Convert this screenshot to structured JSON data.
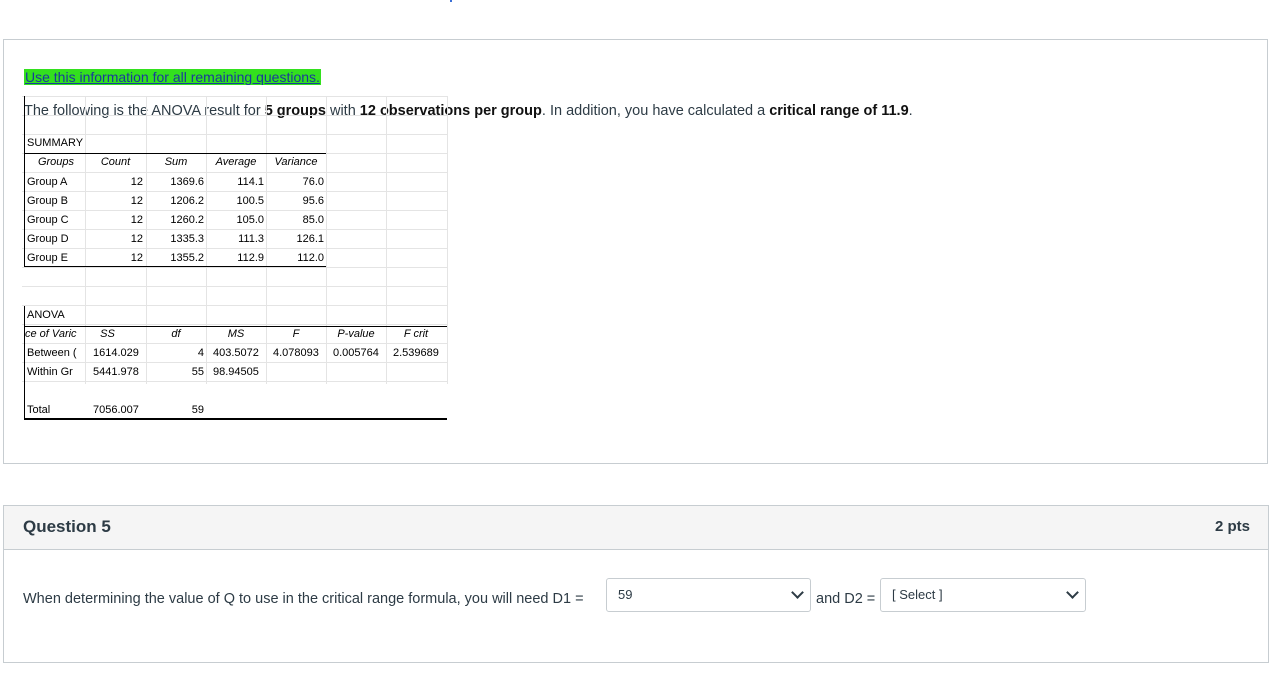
{
  "info": {
    "highlight": "Use this information for all remaining questions.",
    "intro_1": "The following is the ANOVA result for ",
    "intro_2": "5 groups",
    "intro_3": " with ",
    "intro_4": "12 observations per group",
    "intro_5": ". In addition, you have calculated a ",
    "intro_6": "critical range of 11.9",
    "intro_7": "."
  },
  "excel": {
    "summary_label": "SUMMARY",
    "summary_headers": [
      "Groups",
      "Count",
      "Sum",
      "Average",
      "Variance"
    ],
    "summary_rows": [
      [
        "Group A",
        "12",
        "1369.6",
        "114.1",
        "76.0"
      ],
      [
        "Group B",
        "12",
        "1206.2",
        "100.5",
        "95.6"
      ],
      [
        "Group C",
        "12",
        "1260.2",
        "105.0",
        "85.0"
      ],
      [
        "Group D",
        "12",
        "1335.3",
        "111.3",
        "126.1"
      ],
      [
        "Group E",
        "12",
        "1355.2",
        "112.9",
        "112.0"
      ]
    ],
    "anova_label": "ANOVA",
    "anova_headers": [
      "ce of Varic",
      "SS",
      "df",
      "MS",
      "F",
      "P-value",
      "F crit"
    ],
    "anova_rows": [
      [
        "Between (",
        "1614.029",
        "4",
        "403.5072",
        "4.078093",
        "0.005764",
        "2.539689"
      ],
      [
        "Within Gr",
        "5441.978",
        "55",
        "98.94505",
        "",
        "",
        ""
      ]
    ],
    "total_row": [
      "Total",
      "7056.007",
      "59"
    ]
  },
  "question": {
    "title": "Question 5",
    "points": "2 pts",
    "text_before": "When determining the value of Q to use in the critical range formula, you will need D1 =",
    "d1_value": "59",
    "text_middle": "and D2 =",
    "d2_value": "[ Select ]"
  }
}
